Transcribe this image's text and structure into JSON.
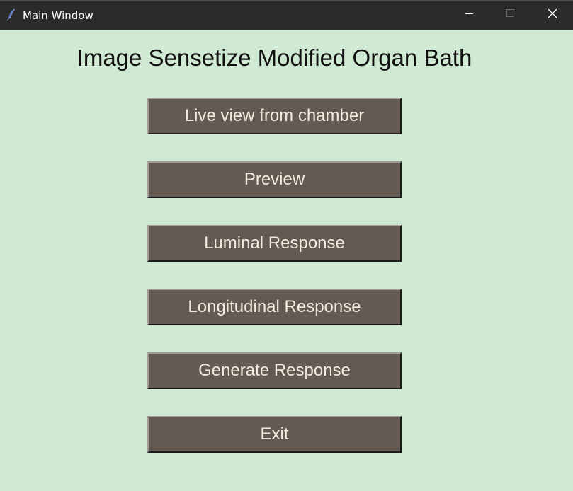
{
  "window": {
    "title": "Main Window",
    "controls": {
      "minimize_icon": "minimize-icon",
      "maximize_icon": "maximize-icon",
      "close_icon": "close-icon"
    }
  },
  "main": {
    "heading": "Image Sensetize Modified Organ Bath",
    "buttons": [
      {
        "label": "Live view from chamber"
      },
      {
        "label": "Preview"
      },
      {
        "label": "Luminal Response"
      },
      {
        "label": "Longitudinal Response"
      },
      {
        "label": "Generate Response"
      },
      {
        "label": "Exit"
      }
    ]
  },
  "colors": {
    "background": "#cfe9d2",
    "titlebar": "#2b2b2b",
    "button_bg": "#635a54",
    "button_text": "#f0ecdc"
  }
}
